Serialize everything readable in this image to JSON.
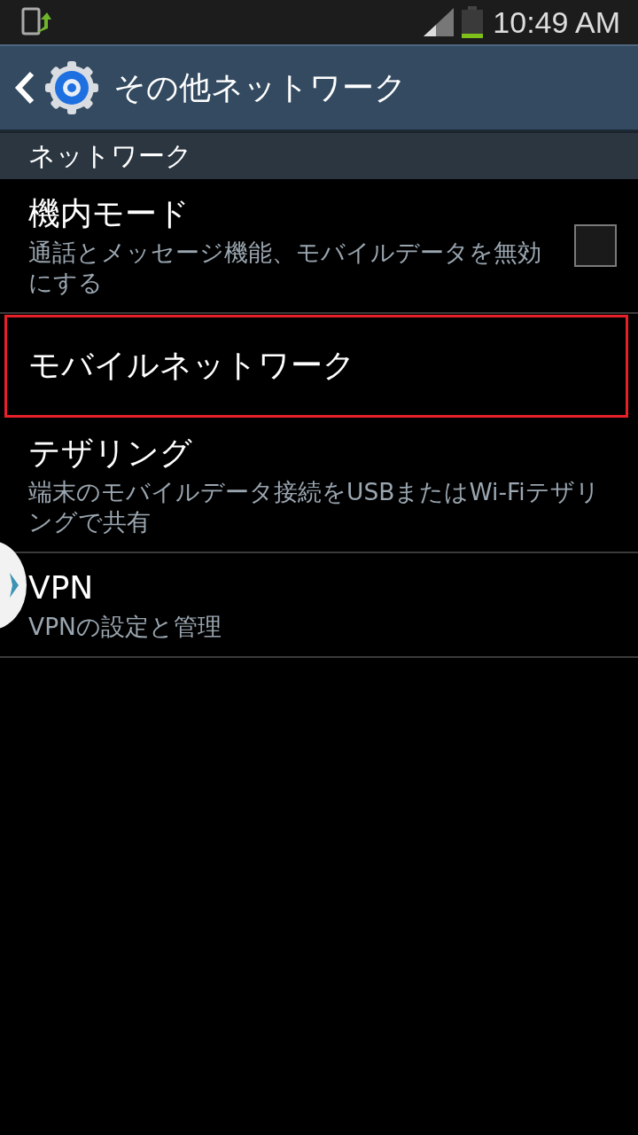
{
  "status_bar": {
    "time": "10:49 AM"
  },
  "header": {
    "title": "その他ネットワーク"
  },
  "section": {
    "title": "ネットワーク"
  },
  "items": [
    {
      "kind": "checkbox",
      "title": "機内モード",
      "subtitle": "通話とメッセージ機能、モバイルデータを無効にする",
      "checked": false,
      "highlighted": false
    },
    {
      "kind": "link",
      "title": "モバイルネットワーク",
      "highlighted": true
    },
    {
      "kind": "link",
      "title": "テザリング",
      "subtitle": "端末のモバイルデータ接続をUSBまたはWi-Fiテザリングで共有",
      "highlighted": false
    },
    {
      "kind": "link",
      "title": "VPN",
      "subtitle": "VPNの設定と管理",
      "highlighted": false
    }
  ]
}
